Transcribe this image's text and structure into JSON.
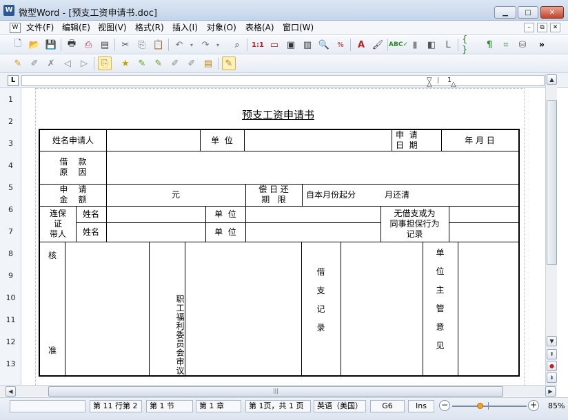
{
  "window": {
    "app_icon": "W",
    "title": "微型Word - [预支工资申请书.doc]",
    "controls": [
      "minimize-icon",
      "maximize-icon",
      "close-icon"
    ]
  },
  "menu": [
    "文件(F)",
    "编辑(E)",
    "视图(V)",
    "格式(R)",
    "插入(I)",
    "对象(O)",
    "表格(A)",
    "窗口(W)"
  ],
  "toolbar_overflow": "»",
  "document": {
    "title": "预支工资申请书",
    "table": {
      "applicant_name": "姓名申请人",
      "unit": "单  位",
      "apply_date_label": "申  请\n日  期",
      "date_value": "年 月 日",
      "loan_reason": "借    款\n原    因",
      "apply_amount": "申    请\n金    额",
      "yuan": "元",
      "repay_period": "偿 日 还\n期   限",
      "repay_text": "自本月份起分",
      "repay_text2": "月还清",
      "guarantor": "连保\n证\n带人",
      "name1": "姓名",
      "unit1": "单  位",
      "history": "无借支或为\n同事担保行为\n记录",
      "name2": "姓名",
      "unit2": "单  位",
      "approve1": "核",
      "approve2": "准",
      "welfare": "职工福利委员会审议",
      "record": "借\n\n支\n\n记\n\n录",
      "supervisor": "单\n\n位\n\n主\n\n管\n\n意\n\n见"
    }
  },
  "ruler": {
    "corner": "L",
    "numbers": [
      "1",
      "2",
      "3",
      "4",
      "5",
      "6",
      "7",
      "8",
      "9",
      "10",
      "11",
      "12",
      "13"
    ]
  },
  "status": {
    "row_col": "第 11 行第 2",
    "section": "第 1 节",
    "chapter": "第 1 章",
    "page": "第 1页，共 1 页",
    "language": "英语（美国）",
    "cell": "G6",
    "mode": "Ins",
    "zoom": "85%"
  },
  "colors": {
    "titlebar": "#c4d5ea",
    "close": "#c3442b",
    "zoom_thumb": "#f0a030"
  }
}
